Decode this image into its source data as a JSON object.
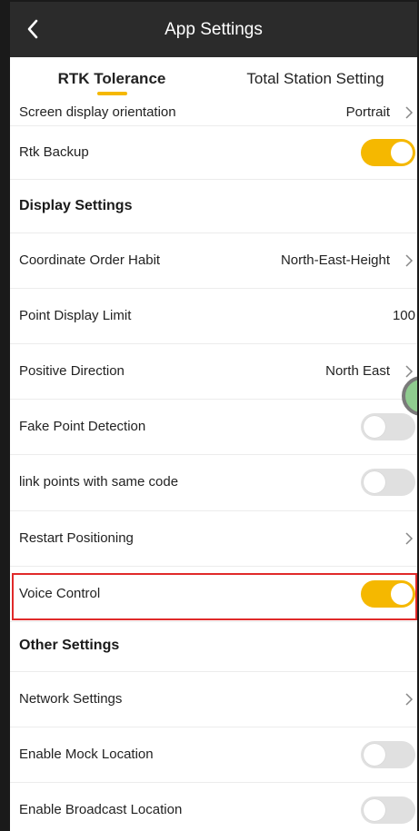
{
  "header": {
    "title": "App Settings",
    "back_icon": "chevron-left-icon"
  },
  "tabs": [
    {
      "label": "RTK Tolerance",
      "active": true
    },
    {
      "label": "Total Station Setting",
      "active": false
    }
  ],
  "colors": {
    "accent": "#f5b800",
    "header_bg": "#2b2b2b",
    "highlight": "#e02a2a",
    "toggle_off": "#e0e0e0"
  },
  "rows": {
    "screen_orientation": {
      "label": "Screen display orientation",
      "value": "Portrait"
    },
    "rtk_backup": {
      "label": "Rtk Backup",
      "toggle": "on"
    },
    "display_settings": {
      "label": "Display Settings"
    },
    "coordinate_order": {
      "label": "Coordinate Order Habit",
      "value": "North-East-Height"
    },
    "point_display_limit": {
      "label": "Point Display Limit",
      "value": "100"
    },
    "positive_direction": {
      "label": "Positive Direction",
      "value": "North East"
    },
    "fake_point_detection": {
      "label": "Fake Point Detection",
      "toggle": "off"
    },
    "link_points": {
      "label": "link points with same code",
      "toggle": "off"
    },
    "restart_positioning": {
      "label": "Restart Positioning"
    },
    "voice_control": {
      "label": "Voice Control",
      "toggle": "on"
    },
    "other_settings": {
      "label": "Other Settings"
    },
    "network_settings": {
      "label": "Network Settings"
    },
    "mock_location": {
      "label": "Enable Mock Location",
      "toggle": "off"
    },
    "broadcast_location": {
      "label": "Enable Broadcast Location",
      "toggle": "off"
    }
  }
}
